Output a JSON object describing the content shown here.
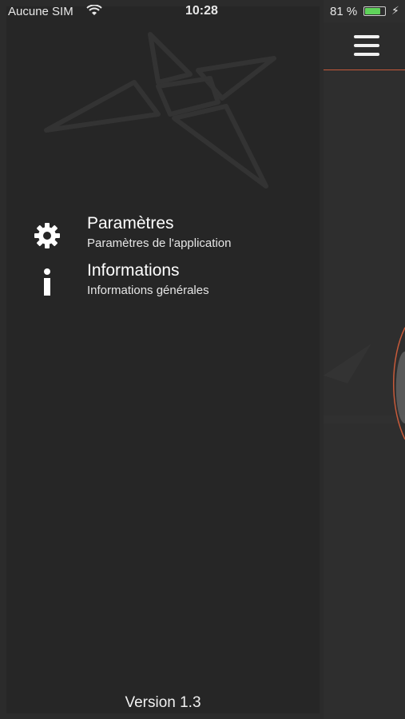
{
  "status_bar": {
    "carrier": "Aucune SIM",
    "time": "10:28",
    "battery_percent": "81 %",
    "battery_level": 0.81
  },
  "drawer": {
    "items": [
      {
        "title": "Paramètres",
        "subtitle": "Paramètres de l'application",
        "icon": "gear-icon"
      },
      {
        "title": "Informations",
        "subtitle": "Informations générales",
        "icon": "info-icon"
      }
    ],
    "version": "Version 1.3"
  },
  "main": {
    "menu_icon": "hamburger-icon",
    "accent_color": "#c65a3a"
  },
  "colors": {
    "drawer_bg": "#262626",
    "background": "#2b2b2b",
    "text": "#ffffff"
  }
}
